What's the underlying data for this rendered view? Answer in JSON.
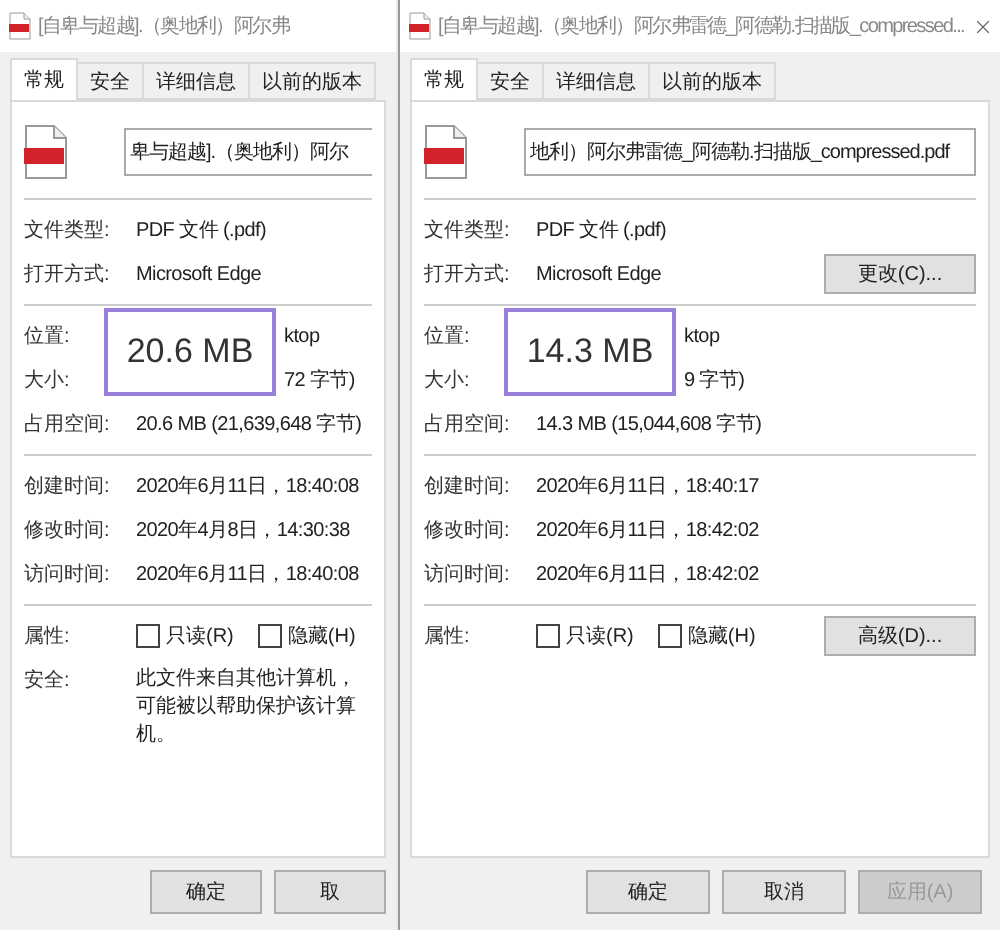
{
  "windows": [
    {
      "title": "[自卑与超越].（奥地利）阿尔弗",
      "closable": false,
      "tabs": [
        {
          "label": "常规",
          "selected": true
        },
        {
          "label": "安全",
          "selected": false
        },
        {
          "label": "详细信息",
          "selected": false
        },
        {
          "label": "以前的版本",
          "selected": false
        }
      ],
      "file_name": "卑与超越].（奥地利）阿尔",
      "details": [
        {
          "label": "文件类型:",
          "value": "PDF 文件 (.pdf)"
        },
        {
          "label": "打开方式:",
          "value": "Microsoft Edge"
        }
      ],
      "size_callout": "20.6 MB",
      "size_rows": [
        {
          "label": "位置:",
          "value": "ktop",
          "behind_callout": true
        },
        {
          "label": "大小:",
          "value": "72 字节)",
          "behind_callout": true
        },
        {
          "label": "占用空间:",
          "value": "20.6 MB (21,639,648 字节)",
          "behind_callout": false
        }
      ],
      "times": [
        {
          "label": "创建时间:",
          "value": "2020年6月11日，18:40:08"
        },
        {
          "label": "修改时间:",
          "value": "2020年4月8日，14:30:38"
        },
        {
          "label": "访问时间:",
          "value": "2020年6月11日，18:40:08"
        }
      ],
      "attributes": {
        "label": "属性:",
        "options": [
          {
            "label": "只读(R)",
            "checked": false
          },
          {
            "label": "隐藏(H)",
            "checked": false
          }
        ]
      },
      "security": {
        "label": "安全:",
        "text": "此文件来自其他计算机，可能被以帮助保护该计算机。"
      },
      "buttons": [
        {
          "label": "确定",
          "disabled": false
        },
        {
          "label": "取",
          "disabled": false
        }
      ]
    },
    {
      "title": "[自卑与超越].（奥地利）阿尔弗雷德_阿德勒.扫描版_compressed...",
      "closable": true,
      "tabs": [
        {
          "label": "常规",
          "selected": true
        },
        {
          "label": "安全",
          "selected": false
        },
        {
          "label": "详细信息",
          "selected": false
        },
        {
          "label": "以前的版本",
          "selected": false
        }
      ],
      "file_name": "地利）阿尔弗雷德_阿德勒.扫描版_compressed.pdf",
      "details": [
        {
          "label": "文件类型:",
          "value": "PDF 文件 (.pdf)"
        },
        {
          "label": "打开方式:",
          "value": "Microsoft Edge",
          "button": "更改(C)..."
        }
      ],
      "size_callout": "14.3 MB",
      "size_rows": [
        {
          "label": "位置:",
          "value": "ktop",
          "behind_callout": true
        },
        {
          "label": "大小:",
          "value": "9 字节)",
          "behind_callout": true
        },
        {
          "label": "占用空间:",
          "value": "14.3 MB (15,044,608 字节)",
          "behind_callout": false
        }
      ],
      "times": [
        {
          "label": "创建时间:",
          "value": "2020年6月11日，18:40:17"
        },
        {
          "label": "修改时间:",
          "value": "2020年6月11日，18:42:02"
        },
        {
          "label": "访问时间:",
          "value": "2020年6月11日，18:42:02"
        }
      ],
      "attributes": {
        "label": "属性:",
        "options": [
          {
            "label": "只读(R)",
            "checked": false
          },
          {
            "label": "隐藏(H)",
            "checked": false
          }
        ],
        "button": "高级(D)..."
      },
      "buttons": [
        {
          "label": "确定",
          "disabled": false
        },
        {
          "label": "取消",
          "disabled": false
        },
        {
          "label": "应用(A)",
          "disabled": true
        }
      ]
    }
  ]
}
